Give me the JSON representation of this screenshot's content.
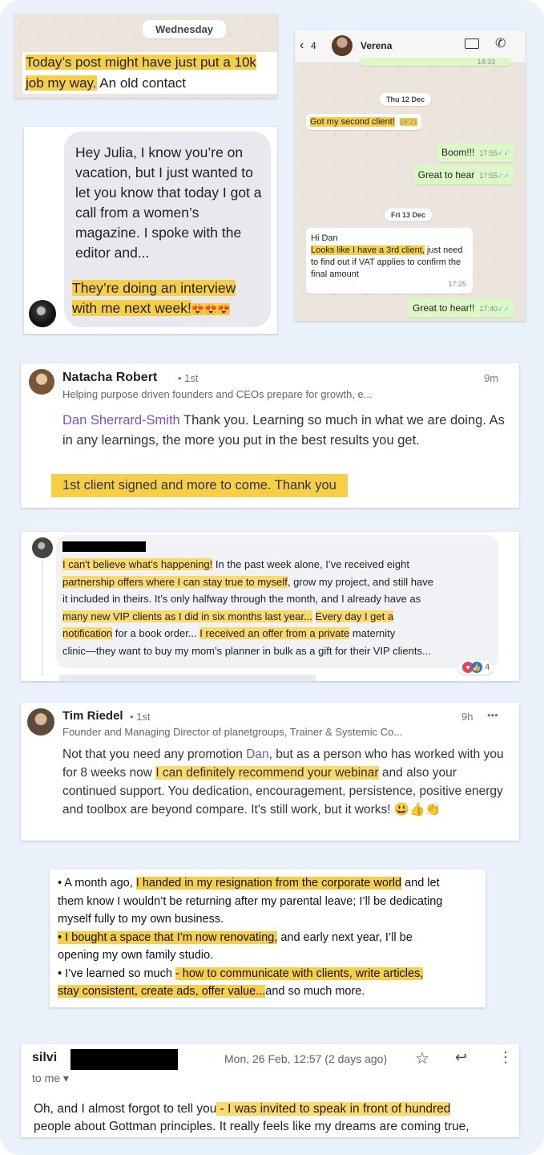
{
  "chat1": {
    "day": "Wednesday",
    "hl": "Today’s post might have just put a 10k job my way.",
    "rest": "An old contact"
  },
  "verena": {
    "back_count": "4",
    "contact": "Verena",
    "top_time": "14:33",
    "date1": "Thu 12 Dec",
    "msg_client": "Got my second client!",
    "msg_client_time": "16:21",
    "msg_boom": "Boom!!!",
    "msg_boom_time": "17:55",
    "msg_great": "Great to hear",
    "msg_great_time": "17:55",
    "date2": "Fri 13 Dec",
    "msg_hi": "Hi Dan",
    "msg_third_hl": "Looks like I have a 3rd client,",
    "msg_third_rest": " just need to find out if VAT applies to confirm the final amount",
    "msg_third_time": "17:25",
    "msg_great2": "Great to hear!!",
    "msg_great2_time": "17:40"
  },
  "julia": {
    "body": "Hey Julia, I know you’re on vacation, but I just wanted to let you know that today I got a call from a women’s magazine. I spoke with the editor and...",
    "hl": "They’re doing an interview with me next week!",
    "emoji": "😍😍😍"
  },
  "natacha": {
    "name": "Natacha Robert",
    "degree": "• 1st",
    "time": "9m",
    "headline": "Helping purpose driven founders and CEOs prepare for growth, e...",
    "mention": "Dan Sherrard-Smith",
    "body": " Thank you. Learning so much in what we are doing. As in any learnings, the more you put in the best results you get.",
    "hl": "1st client signed and more to come. Thank you"
  },
  "fb": {
    "p1_hl": "I can't believe what’s happening!",
    "p1_a": " In the past week alone, I’ve received eight ",
    "p2_hl": "partnership offers where I can stay true to myself",
    "p2_a": ", grow my project, and still have",
    "p3": "it included in theirs. It’s only halfway through the month, and I already have as",
    "p4_hl": "many new VIP clients as I did in six months last year...",
    "p4_hl2": "Every day I get a",
    "p5_hl": "notification",
    "p5_a": " for a book order... ",
    "p5_hl2": "I received an offer from a private",
    "p5_b": " maternity",
    "p6": "clinic—they want to buy my mom’s planner in bulk as a gift for their VIP clients...",
    "reactions": "4"
  },
  "tim": {
    "name": "Tim Riedel",
    "degree": "• 1st",
    "time": "9h",
    "more": "•••",
    "headline": "Founder and Managing Director of planetgroups, Trainer & Systemic Co...",
    "b1": "Not that you need any promotion ",
    "mention": "Dan",
    "b2": ", but as a person who has worked with you for 8 weeks now ",
    "hl": "I can definitely recommend your webinar",
    "b3": " and also your continued support. You dedication, encouragement, persistence, positive energy and toolbox are beyond compare. It's still work, but it works! ",
    "emoji": "😃👍👏"
  },
  "bullets": {
    "l1a": "• A month ago, ",
    "l1hl": "I handed in my resignation from the corporate world",
    "l1b": " and let",
    "l2": "them know I wouldn’t be returning after my parental leave; I’ll be dedicating",
    "l3": "myself fully to my own business.",
    "l4hl": "• I bought a space that I’m now renovating,",
    "l4b": " and early next year, I’ll be",
    "l5": "opening my own family studio.",
    "l6a": "• I’ve learned so much ",
    "l6hl": "- how to communicate with clients, write articles,",
    "l7hl": "stay consistent, create ads, offer value...",
    "l7b": "and so much more."
  },
  "email": {
    "sender": "silvi",
    "date": "Mon, 26 Feb, 12:57 (2 days ago)",
    "to": "to me ▾",
    "l1a": "Oh, and I almost forgot to tell you",
    "l1hl": " - I was invited to speak in front of hundred",
    "l2": "people about Gottman principles. It really feels like my dreams are coming true,"
  },
  "colors": {
    "highlight": "#f7cf45",
    "whatsapp_out": "#dcf8c6",
    "mention": "#7b4fd6",
    "frame": "#eaf1fb"
  }
}
